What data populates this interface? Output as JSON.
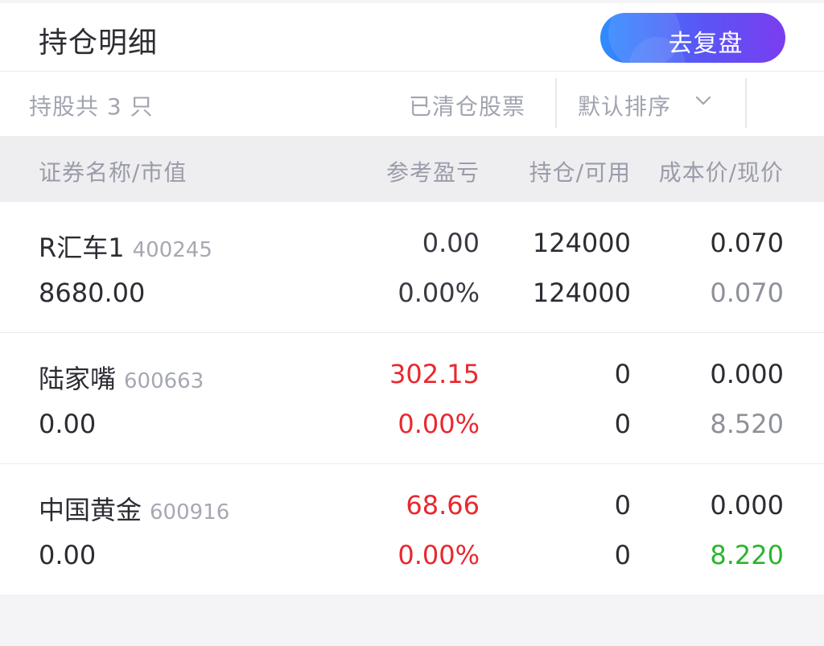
{
  "header": {
    "title": "持仓明细",
    "review_button": "去复盘"
  },
  "subbar": {
    "count_label": "持股共 3 只",
    "cleared_label": "已清仓股票",
    "sort_label": "默认排序"
  },
  "columns": {
    "name": "证券名称/市值",
    "pl": "参考盈亏",
    "position": "持仓/可用",
    "price": "成本价/现价"
  },
  "colors": {
    "neutral": "#3a3a44",
    "up": "#e8282f",
    "down": "#2cb52e",
    "muted": "#8e909a",
    "accent_start": "#2f8cff",
    "accent_end": "#7a3df0"
  },
  "holdings": [
    {
      "name": "R汇车1",
      "code": "400245",
      "market_value": "8680.00",
      "pl": "0.00",
      "pl_pct": "0.00%",
      "position": "124000",
      "available": "124000",
      "cost": "0.070",
      "current": "0.070",
      "pl_color": "#3a3a44",
      "current_color": "#8e909a"
    },
    {
      "name": "陆家嘴",
      "code": "600663",
      "market_value": "0.00",
      "pl": "302.15",
      "pl_pct": "0.00%",
      "position": "0",
      "available": "0",
      "cost": "0.000",
      "current": "8.520",
      "pl_color": "#e8282f",
      "current_color": "#8e909a"
    },
    {
      "name": "中国黄金",
      "code": "600916",
      "market_value": "0.00",
      "pl": "68.66",
      "pl_pct": "0.00%",
      "position": "0",
      "available": "0",
      "cost": "0.000",
      "current": "8.220",
      "pl_color": "#e8282f",
      "current_color": "#2cb52e"
    }
  ]
}
